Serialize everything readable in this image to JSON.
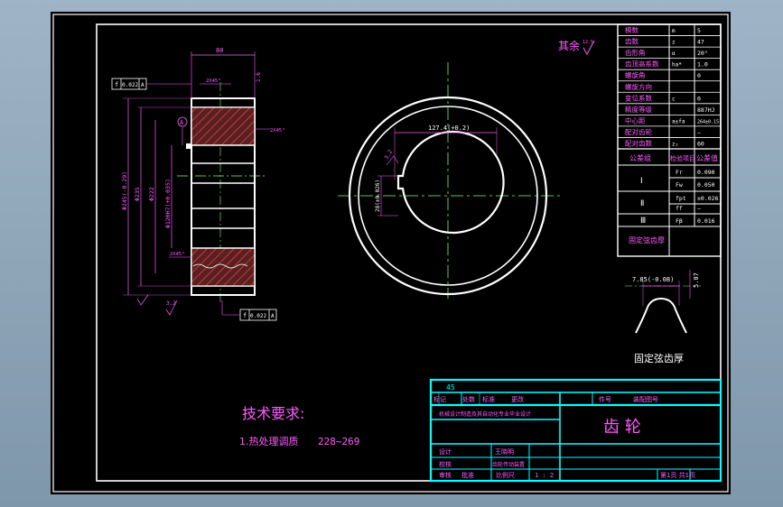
{
  "params": {
    "rows": [
      {
        "label": "模数",
        "sym": "m",
        "val": "5"
      },
      {
        "label": "齿数",
        "sym": "z",
        "val": "47"
      },
      {
        "label": "齿形角",
        "sym": "α",
        "val": "20°"
      },
      {
        "label": "齿顶高系数",
        "sym": "ha*",
        "val": "1.0"
      },
      {
        "label": "螺旋角",
        "sym": "",
        "val": "0"
      },
      {
        "label": "螺旋方向",
        "sym": "",
        "val": ""
      },
      {
        "label": "变位系数",
        "sym": "c",
        "val": "0"
      },
      {
        "label": "精度等级",
        "sym": "",
        "val": "887HJ"
      },
      {
        "label": "中心距",
        "sym": "a±fa",
        "val": "264±0.15"
      },
      {
        "label": "配对齿轮",
        "sym": "",
        "val": "—"
      },
      {
        "label": "配对齿数",
        "sym": "z₂",
        "val": "60"
      }
    ],
    "tol_header": {
      "group": "公差组",
      "item": "检验项目",
      "value": "公差值"
    },
    "tol_groups": [
      "Ⅰ",
      "Ⅱ",
      "Ⅲ"
    ],
    "tol_rows": [
      {
        "sym": "Fr",
        "val": "0.090"
      },
      {
        "sym": "Fw",
        "val": "0.050"
      },
      {
        "sym": "fpt",
        "val": "±0.026"
      },
      {
        "sym": "ff",
        "val": "—"
      },
      {
        "sym": "Fβ",
        "val": "0.016"
      }
    ],
    "fixed_chord_label": "固定弦齿厚"
  },
  "roughness_note": "其余",
  "roughness_value": "12.5",
  "side_view": {
    "tol_top": "0.022",
    "datum_top": "A",
    "tol_bottom": "0.022",
    "datum_bottom": "A",
    "width": "80",
    "chamfer_top": "2X45°",
    "chamfer_right": "2X45°",
    "chamfer_bottom": "2X45°",
    "dia_tip": "Φ245(-0.29)",
    "dia_root": "Φ235",
    "dia_hub": "Φ222",
    "dia_bore": "Φ120H7(+0.035)",
    "datum_mark": "A",
    "rough_top": "1.6",
    "rough_bottom": "3.2"
  },
  "front_view": {
    "keyway_depth": "127.4(+0.2)",
    "keyway_width": "28(±0.026)",
    "rough": "3.2"
  },
  "chord_detail": {
    "width_label": "7.85(-0.08)",
    "height_label": "5.07"
  },
  "tech_req": {
    "title": "技术要求:",
    "item1": "1.热处理调质",
    "item1_value": "228~269"
  },
  "title_block": {
    "material": "45",
    "design_labels": [
      "标准",
      "更改"
    ],
    "mark_labels": [
      "标记",
      "处数"
    ],
    "figure_label": "件号",
    "drawing_no_label": "装配图号",
    "school": "机械设计制造及其自动化专业毕业设计",
    "part_name": "齿  轮",
    "row_labels": [
      "设计",
      "校核",
      "审核",
      "批准"
    ],
    "designer": "王晓明",
    "checker": "齿轮传动装置",
    "scale_label": "比例尺",
    "scale_value": "1 : 2",
    "sheet_text": "第1页 共1页"
  }
}
